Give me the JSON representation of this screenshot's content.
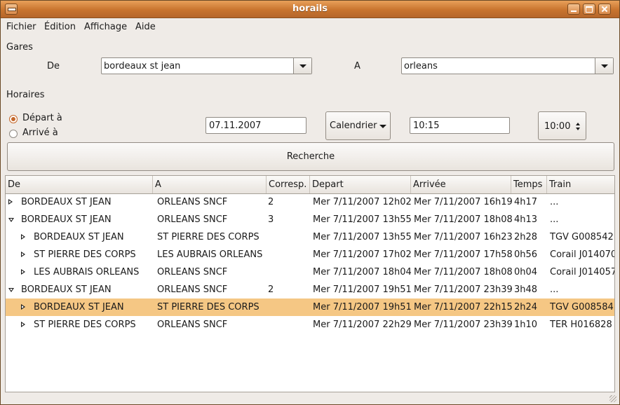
{
  "window": {
    "title": "horails"
  },
  "menu": [
    {
      "label": "Fichier"
    },
    {
      "label": "Édition"
    },
    {
      "label": "Affichage"
    },
    {
      "label": "Aide"
    }
  ],
  "gares": {
    "section_label": "Gares",
    "from_label": "De",
    "from_value": "bordeaux st jean",
    "to_label": "A",
    "to_value": "orleans"
  },
  "horaires": {
    "section_label": "Horaires",
    "radio_depart": "Départ à",
    "radio_arrive": "Arrivé à",
    "selected": "depart",
    "date_value": "07.11.2007",
    "calendar_button": "Calendrier",
    "time_value": "10:15",
    "spin_value": "10:00"
  },
  "search_button": "Recherche",
  "table": {
    "columns": [
      "De",
      "A",
      "Corresp.",
      "Depart",
      "Arrivée",
      "Temps",
      "Train"
    ],
    "rows": [
      {
        "level": 0,
        "expander": "closed",
        "cells": [
          "BORDEAUX ST JEAN",
          "ORLEANS SNCF",
          "2",
          "Mer 7/11/2007 12h02",
          "Mer 7/11/2007 16h19",
          "4h17",
          "..."
        ]
      },
      {
        "level": 0,
        "expander": "open",
        "cells": [
          "BORDEAUX ST JEAN",
          "ORLEANS SNCF",
          "3",
          "Mer 7/11/2007 13h55",
          "Mer 7/11/2007 18h08",
          "4h13",
          "..."
        ]
      },
      {
        "level": 1,
        "expander": "closed",
        "cells": [
          "BORDEAUX ST JEAN",
          "ST PIERRE DES CORPS",
          "",
          "Mer 7/11/2007 13h55",
          "Mer 7/11/2007 16h23",
          "2h28",
          "TGV G008542"
        ]
      },
      {
        "level": 1,
        "expander": "closed",
        "cells": [
          "ST PIERRE DES CORPS",
          "LES AUBRAIS ORLEANS",
          "",
          "Mer 7/11/2007 17h02",
          "Mer 7/11/2007 17h58",
          "0h56",
          "Corail J014070"
        ]
      },
      {
        "level": 1,
        "expander": "closed",
        "cells": [
          "LES AUBRAIS ORLEANS",
          "ORLEANS SNCF",
          "",
          "Mer 7/11/2007 18h04",
          "Mer 7/11/2007 18h08",
          "0h04",
          "Corail J014057"
        ]
      },
      {
        "level": 0,
        "expander": "open",
        "cells": [
          "BORDEAUX ST JEAN",
          "ORLEANS SNCF",
          "2",
          "Mer 7/11/2007 19h51",
          "Mer 7/11/2007 23h39",
          "3h48",
          "..."
        ]
      },
      {
        "level": 1,
        "expander": "closed",
        "selected": true,
        "cells": [
          "BORDEAUX ST JEAN",
          "ST PIERRE DES CORPS",
          "",
          "Mer 7/11/2007 19h51",
          "Mer 7/11/2007 22h15",
          "2h24",
          "TGV G008584"
        ]
      },
      {
        "level": 1,
        "expander": "closed",
        "cells": [
          "ST PIERRE DES CORPS",
          "ORLEANS SNCF",
          "",
          "Mer 7/11/2007 22h29",
          "Mer 7/11/2007 23h39",
          "1h10",
          "TER H016828"
        ]
      }
    ]
  }
}
